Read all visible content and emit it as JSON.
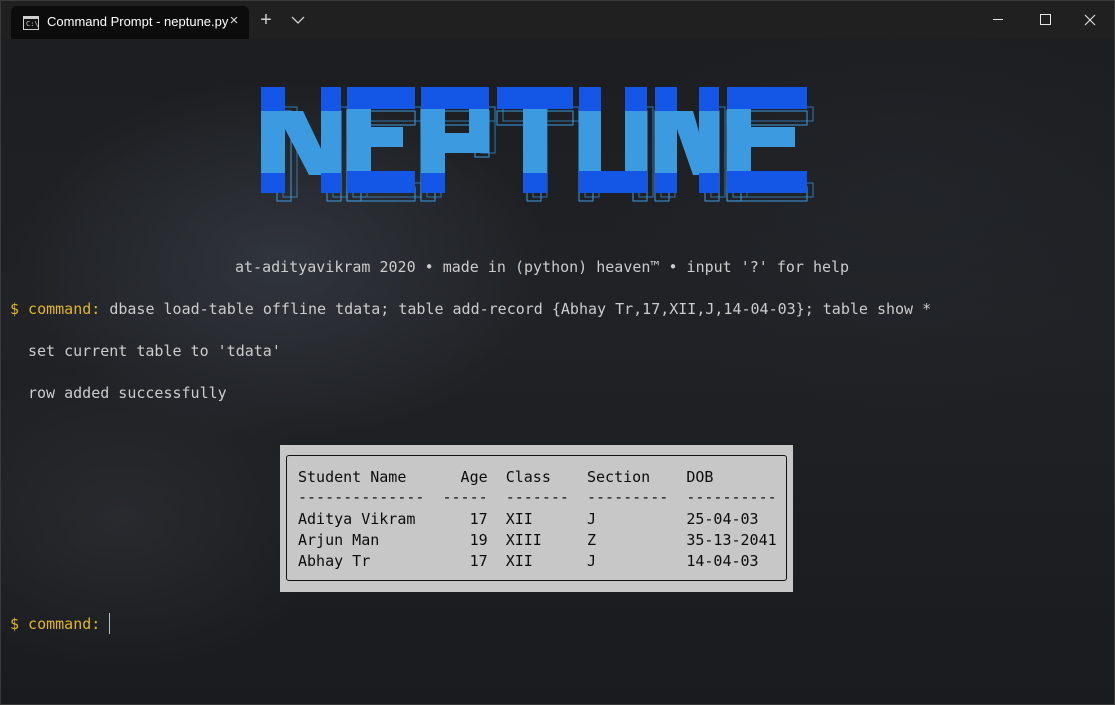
{
  "titlebar": {
    "tab_title": "Command Prompt - neptune.py",
    "tab_icon_text": "C:\\",
    "close_tab_glyph": "×",
    "new_tab_glyph": "+",
    "dropdown_icon": "chevron-down-icon",
    "window_controls": [
      "minimize-icon",
      "maximize-icon",
      "close-icon"
    ]
  },
  "logo": {
    "text": "NEPTUNE",
    "colors": {
      "light": "#3c9be0",
      "dark": "#1456e6",
      "outline": "#3c9be0"
    }
  },
  "terminal": {
    "tagline": "at-adityavikram 2020 • made in (python) heaven™ • input '?' for help",
    "prompt_label": "$ command:",
    "command_text": " dbase load-table offline tdata; table add-record {Abhay Tr,17,XII,J,14-04-03}; table show *",
    "output": [
      "set current table to 'tdata'",
      "row added successfully"
    ],
    "prompt2_label": "$ command:"
  },
  "table": {
    "header": "Student Name      Age  Class    Section    DOB",
    "separator": "--------------  -----  -------  ---------  ----------",
    "rows": [
      "Aditya Vikram      17  XII      J          25-04-03",
      "Arjun Man          19  XIII     Z          35-13-2041",
      "Abhay Tr           17  XII      J          14-04-03"
    ]
  },
  "colors": {
    "prompt": "#e0b52a",
    "text": "#cccccc",
    "table_bg": "#c7c7c7"
  }
}
